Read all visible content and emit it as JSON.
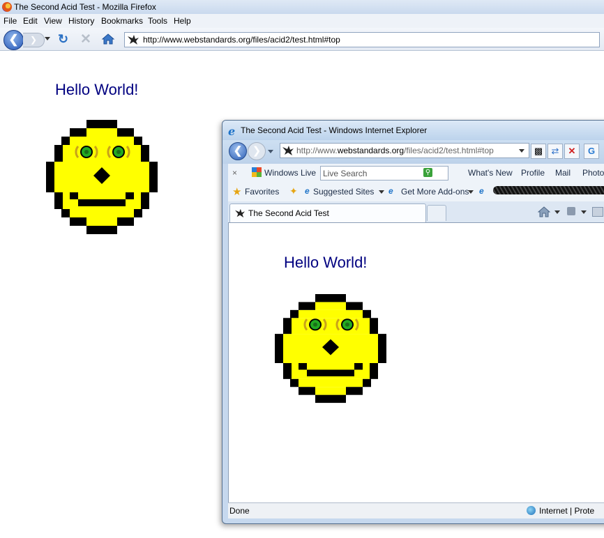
{
  "firefox": {
    "title": "The Second Acid Test - Mozilla Firefox",
    "menu": [
      "File",
      "Edit",
      "View",
      "History",
      "Bookmarks",
      "Tools",
      "Help"
    ],
    "url": "http://www.webstandards.org/files/acid2/test.html#top",
    "content": {
      "heading": "Hello World!"
    }
  },
  "ie": {
    "title": "The Second Acid Test - Windows Internet Explorer",
    "url_prefix": "http://www.",
    "url_domain": "webstandards.org",
    "url_path": "/files/acid2/test.html#top",
    "links_bar": {
      "close": "×",
      "windows_live": "Windows Live",
      "search_placeholder": "Live Search",
      "whats_new": "What's New",
      "profile": "Profile",
      "mail": "Mail",
      "photos": "Photo"
    },
    "favorites_bar": {
      "favorites": "Favorites",
      "suggested": "Suggested Sites",
      "addons": "Get More Add-ons"
    },
    "tab_title": "The Second Acid Test",
    "content": {
      "heading": "Hello World!"
    },
    "status": {
      "left": "Done",
      "zone": "Internet | Prote"
    }
  },
  "colors": {
    "face_yellow": "#ffff00",
    "eye_green": "#22aa22",
    "heading_blue": "#000080"
  }
}
